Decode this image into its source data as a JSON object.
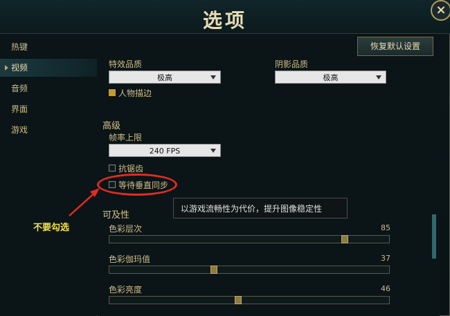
{
  "window": {
    "title": "选项",
    "close_label": "×"
  },
  "sidebar": {
    "items": [
      {
        "label": "热键"
      },
      {
        "label": "视频",
        "active": true
      },
      {
        "label": "音频"
      },
      {
        "label": "界面"
      },
      {
        "label": "游戏"
      }
    ]
  },
  "toolbar": {
    "reset_label": "恢复默认设置"
  },
  "video": {
    "effects_quality": {
      "label": "特效品质",
      "value": "极高"
    },
    "shadow_quality": {
      "label": "阴影品质",
      "value": "极高"
    },
    "character_outline": {
      "label": "人物描边",
      "checked": true
    },
    "advanced_header": "高级",
    "frame_rate": {
      "label": "帧率上限",
      "value": "240 FPS"
    },
    "antialiasing": {
      "label": "抗锯齿",
      "checked": false
    },
    "vsync": {
      "label": "等待垂直同步",
      "checked": false
    }
  },
  "accessibility": {
    "header": "可及性",
    "sliders": [
      {
        "label": "色彩层次",
        "value": "85",
        "fraction": 0.85
      },
      {
        "label": "色彩伽玛值",
        "value": "37",
        "fraction": 0.37
      },
      {
        "label": "色彩亮度",
        "value": "46",
        "fraction": 0.46
      }
    ]
  },
  "tooltip": {
    "text": "以游戏流畅性为代价，提升图像稳定性"
  },
  "annotation": {
    "text": "不要勾选",
    "color": "#e32b23"
  }
}
